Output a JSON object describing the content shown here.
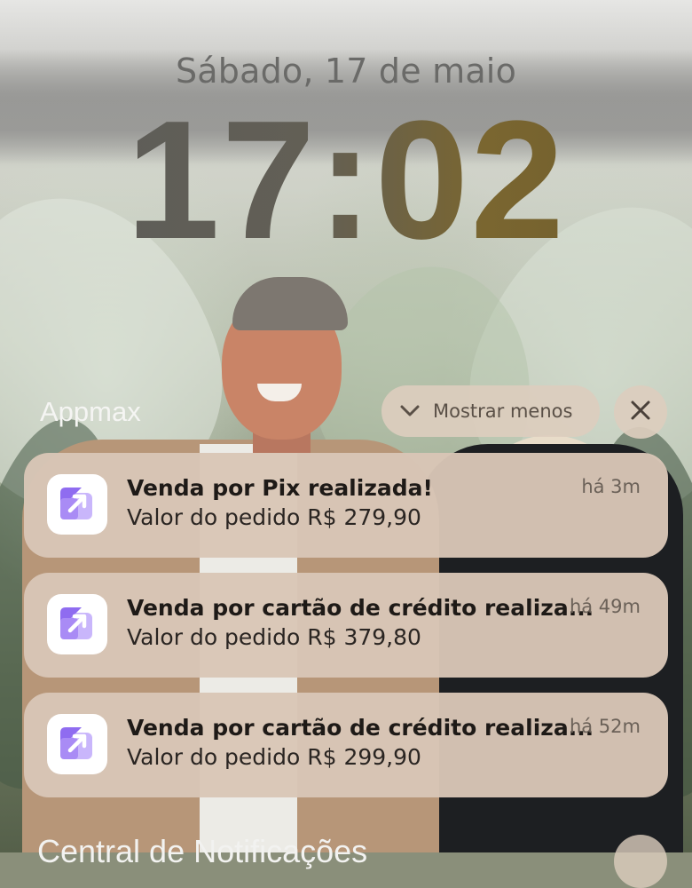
{
  "lockscreen": {
    "date": "Sábado, 17 de maio",
    "time": "17:02"
  },
  "group": {
    "app_name": "Appmax",
    "show_less_label": "Mostrar menos",
    "show_less_icon": "chevron-down-icon",
    "close_icon": "close-icon"
  },
  "notifications": [
    {
      "title": "Venda por Pix realizada!",
      "body": "Valor do pedido R$ 279,90",
      "time": "há 3m",
      "icon": "appmax-logo-icon"
    },
    {
      "title": "Venda por cartão de crédito realiza...",
      "body": "Valor do pedido R$ 379,80",
      "time": "há 49m",
      "icon": "appmax-logo-icon"
    },
    {
      "title": "Venda por cartão de crédito realiza...",
      "body": "Valor do pedido R$ 299,90",
      "time": "há 52m",
      "icon": "appmax-logo-icon"
    }
  ],
  "bottom": {
    "partial_text": "Central de Notificações"
  },
  "colors": {
    "notification_bg": "#d8c6b6",
    "icon_accent": "#8f6cf0",
    "icon_accent_light": "#c9b6fb"
  }
}
